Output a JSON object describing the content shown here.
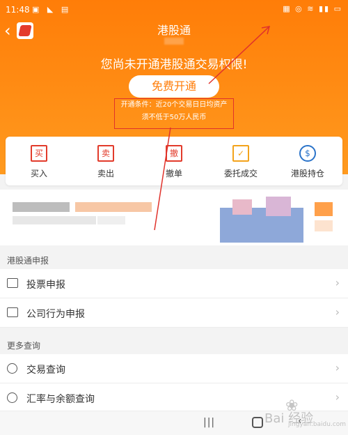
{
  "status_bar": {
    "time": "11:48"
  },
  "header": {
    "title": "港股通",
    "notice": "您尚未开通港股通交易权限!",
    "open_button": "免费开通",
    "condition_line1": "开通条件：近20个交易日日均资产",
    "condition_line2": "须不低于50万人民币"
  },
  "quick_actions": [
    {
      "icon_char": "买",
      "label": "买入"
    },
    {
      "icon_char": "卖",
      "label": "卖出"
    },
    {
      "icon_char": "撤",
      "label": "撤单"
    },
    {
      "icon_char": "✓",
      "label": "委托成交"
    },
    {
      "icon_char": "$",
      "label": "港股持仓"
    }
  ],
  "sections": [
    {
      "header": "港股通申报",
      "items": [
        "投票申报",
        "公司行为申报"
      ]
    },
    {
      "header": "更多查询",
      "items": [
        "交易查询",
        "汇率与余额查询"
      ]
    }
  ],
  "watermark": {
    "text": "Bai 经验",
    "url": "jingyan.baidu.com"
  },
  "colors": {
    "accent": "#ff7d08",
    "alert_red": "#e23b2b"
  }
}
